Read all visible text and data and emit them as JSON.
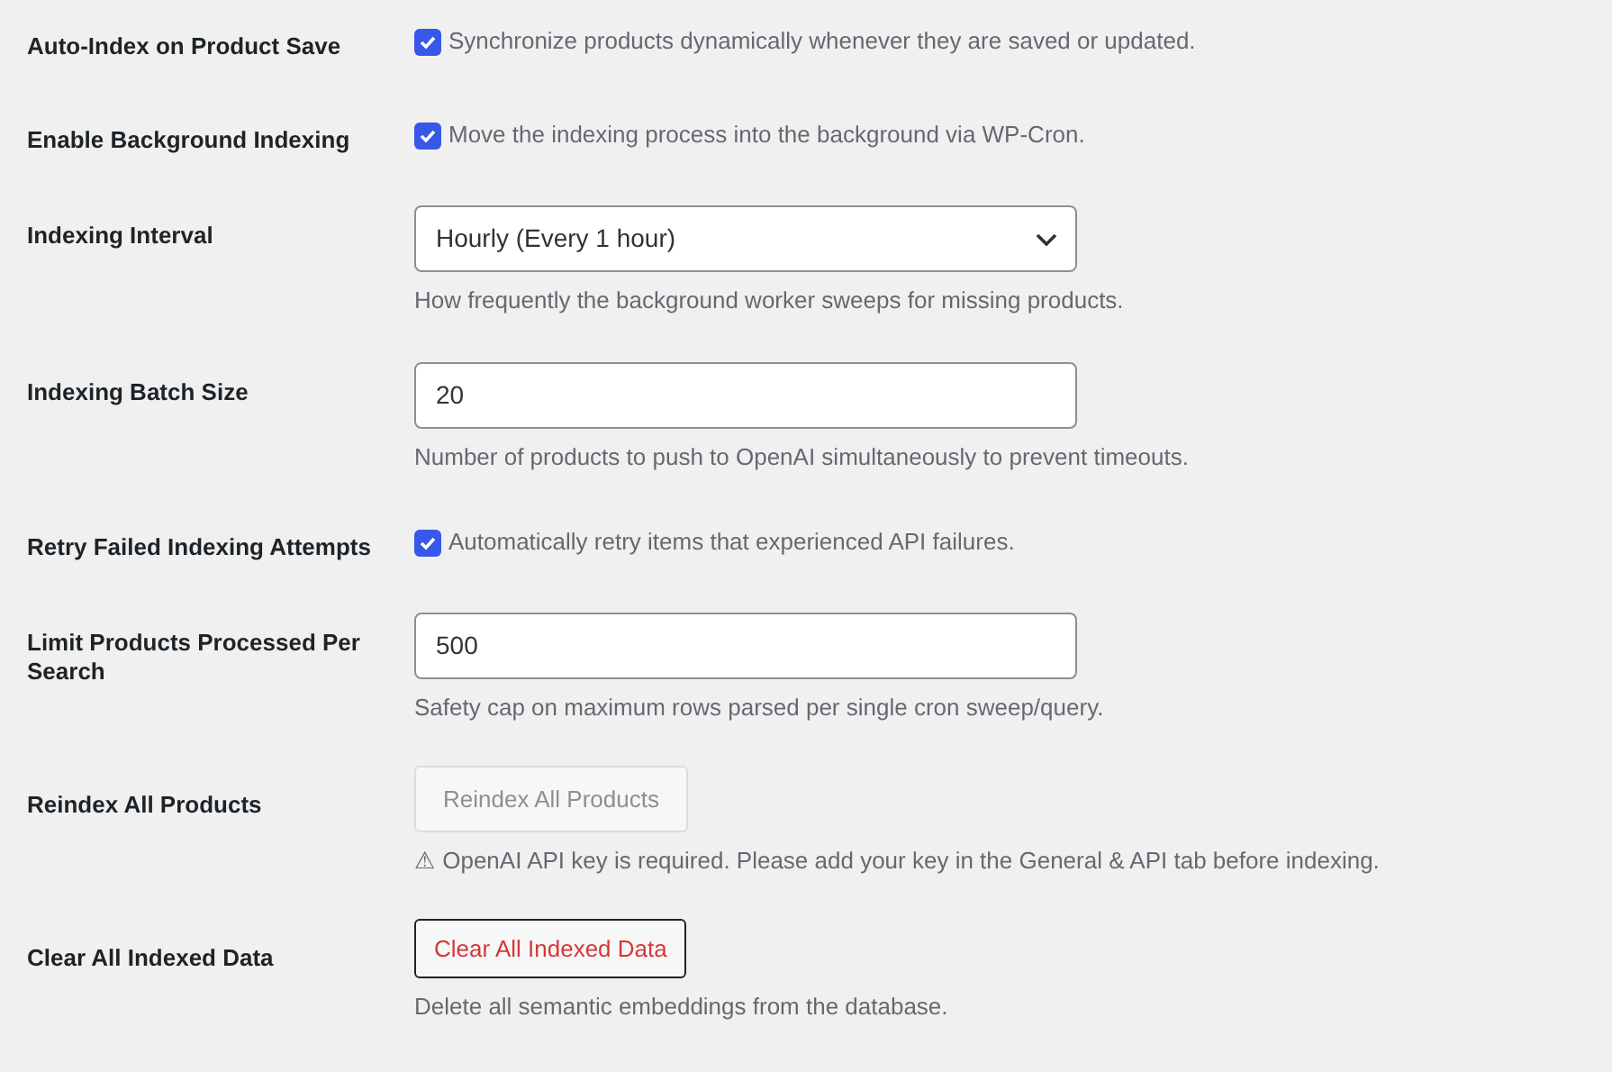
{
  "settings": [
    {
      "label": "Auto-Index on Product Save",
      "kind": "checkbox",
      "checked": true,
      "text": "Synchronize products dynamically whenever they are saved or updated."
    },
    {
      "label": "Enable Background Indexing",
      "kind": "checkbox",
      "checked": true,
      "text": "Move the indexing process into the background via WP-Cron."
    },
    {
      "label": "Indexing Interval",
      "kind": "select",
      "value": "Hourly (Every 1 hour)",
      "description": "How frequently the background worker sweeps for missing products."
    },
    {
      "label": "Indexing Batch Size",
      "kind": "input",
      "value": "20",
      "description": "Number of products to push to OpenAI simultaneously to prevent timeouts."
    },
    {
      "label": "Retry Failed Indexing Attempts",
      "kind": "checkbox",
      "checked": true,
      "text": "Automatically retry items that experienced API failures."
    },
    {
      "label": "Limit Products Processed Per Search",
      "kind": "input",
      "value": "500",
      "description": "Safety cap on maximum rows parsed per single cron sweep/query."
    },
    {
      "label": "Reindex All Products",
      "kind": "button",
      "button": "Reindex All Products",
      "disabled": true,
      "danger": false,
      "description": "⚠ OpenAI API key is required. Please add your key in the General & API tab before indexing."
    },
    {
      "label": "Clear All Indexed Data",
      "kind": "button",
      "button": "Clear All Indexed Data",
      "disabled": false,
      "danger": true,
      "description": "Delete all semantic embeddings from the database."
    }
  ]
}
